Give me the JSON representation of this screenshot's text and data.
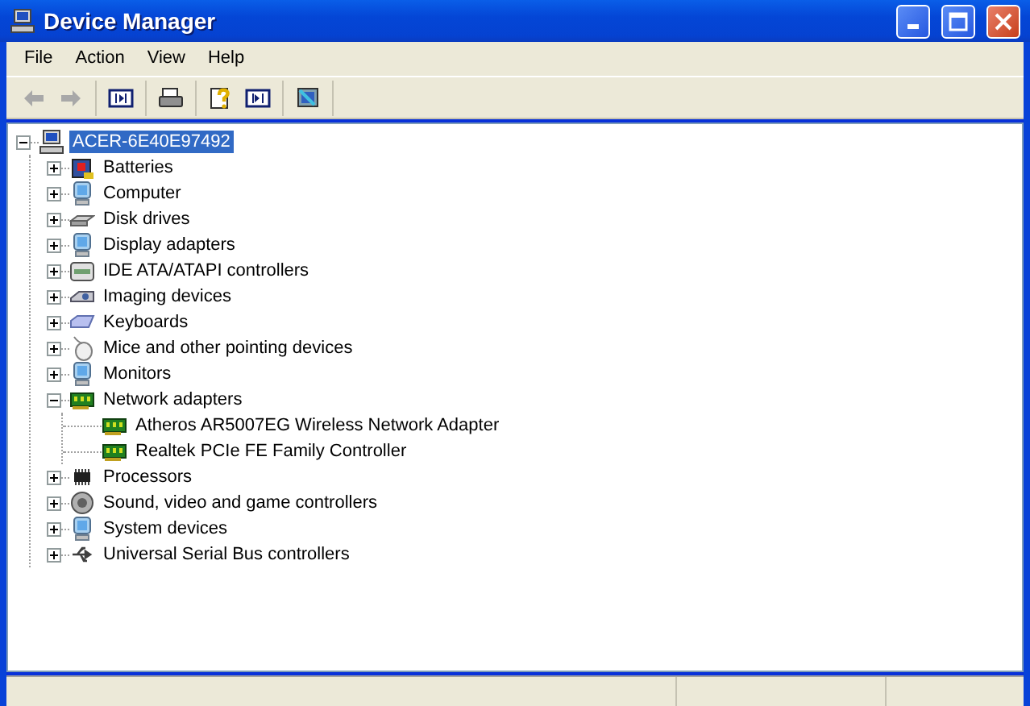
{
  "window": {
    "title": "Device Manager"
  },
  "menu": [
    "File",
    "Action",
    "View",
    "Help"
  ],
  "toolbar": [
    [
      {
        "kind": "back",
        "disabled": true
      },
      {
        "kind": "forward",
        "disabled": true
      }
    ],
    [
      {
        "kind": "pane"
      }
    ],
    [
      {
        "kind": "print"
      }
    ],
    [
      {
        "kind": "help"
      },
      {
        "kind": "pane2"
      }
    ],
    [
      {
        "kind": "scan"
      }
    ]
  ],
  "tree": {
    "label": "ACER-6E40E97492",
    "kind": "computer",
    "selected": true,
    "expanded": true,
    "children": [
      {
        "label": "Batteries",
        "kind": "battery",
        "selected": false,
        "expanded": false
      },
      {
        "label": "Computer",
        "kind": "monitor",
        "selected": false,
        "expanded": false
      },
      {
        "label": "Disk drives",
        "kind": "disk",
        "selected": false,
        "expanded": false
      },
      {
        "label": "Display adapters",
        "kind": "monitor",
        "selected": false,
        "expanded": false
      },
      {
        "label": "IDE ATA/ATAPI controllers",
        "kind": "ide",
        "selected": false,
        "expanded": false
      },
      {
        "label": "Imaging devices",
        "kind": "camera",
        "selected": false,
        "expanded": false
      },
      {
        "label": "Keyboards",
        "kind": "keyboard",
        "selected": false,
        "expanded": false
      },
      {
        "label": "Mice and other pointing devices",
        "kind": "mouse",
        "selected": false,
        "expanded": false
      },
      {
        "label": "Monitors",
        "kind": "monitor",
        "selected": false,
        "expanded": false
      },
      {
        "label": "Network adapters",
        "kind": "network",
        "selected": false,
        "expanded": true,
        "children": [
          {
            "label": "Atheros AR5007EG Wireless Network Adapter",
            "kind": "network",
            "selected": false
          },
          {
            "label": "Realtek PCIe FE Family Controller",
            "kind": "network",
            "selected": false
          }
        ]
      },
      {
        "label": "Processors",
        "kind": "cpu",
        "selected": false,
        "expanded": false
      },
      {
        "label": "Sound, video and game controllers",
        "kind": "sound",
        "selected": false,
        "expanded": false
      },
      {
        "label": "System devices",
        "kind": "monitor",
        "selected": false,
        "expanded": false
      },
      {
        "label": "Universal Serial Bus controllers",
        "kind": "usb",
        "selected": false,
        "expanded": false
      }
    ]
  }
}
